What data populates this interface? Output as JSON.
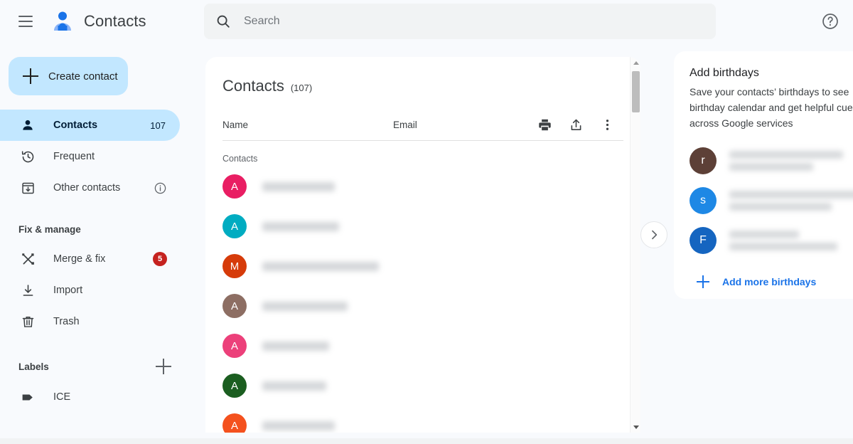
{
  "app": {
    "title": "Contacts",
    "logo_icon": "contacts-person-logo"
  },
  "topbar": {
    "menu_icon": "hamburger-menu-icon",
    "help_icon": "help-circle-icon",
    "search": {
      "icon": "search-icon",
      "placeholder": "Search",
      "value": ""
    }
  },
  "sidebar": {
    "create_button": {
      "label": "Create contact",
      "icon": "plus-icon"
    },
    "nav": [
      {
        "label": "Contacts",
        "icon": "person-icon",
        "count": "107",
        "active": true
      },
      {
        "label": "Frequent",
        "icon": "history-icon",
        "count": "",
        "active": false
      },
      {
        "label": "Other contacts",
        "icon": "archive-down-icon",
        "count": "",
        "active": false,
        "trailing_icon": "info-circle-icon"
      }
    ],
    "fix_section_title": "Fix & manage",
    "fix_items": [
      {
        "label": "Merge & fix",
        "icon": "merge-tools-icon",
        "badge": "5"
      },
      {
        "label": "Import",
        "icon": "download-icon",
        "badge": ""
      },
      {
        "label": "Trash",
        "icon": "trash-icon",
        "badge": ""
      }
    ],
    "labels_section_title": "Labels",
    "add_label_icon": "plus-icon",
    "labels": [
      {
        "label": "ICE",
        "icon": "label-tag-icon"
      }
    ]
  },
  "main": {
    "title": "Contacts",
    "count": "(107)",
    "columns": {
      "name": "Name",
      "email": "Email"
    },
    "actions": [
      {
        "name": "print-button",
        "icon": "print-icon"
      },
      {
        "name": "export-button",
        "icon": "upload-icon"
      },
      {
        "name": "more-options-button",
        "icon": "more-vertical-icon"
      }
    ],
    "group_label": "Contacts",
    "rows": [
      {
        "initial": "A",
        "color": "#e91e63",
        "name_width": 102
      },
      {
        "initial": "A",
        "color": "#00acc1",
        "name_width": 108
      },
      {
        "initial": "M",
        "color": "#d63b0a",
        "name_width": 164
      },
      {
        "initial": "A",
        "color": "#8d6e63",
        "name_width": 120
      },
      {
        "initial": "A",
        "color": "#ec407a",
        "name_width": 94
      },
      {
        "initial": "A",
        "color": "#1b5e20",
        "name_width": 90
      },
      {
        "initial": "A",
        "color": "#f4511e",
        "name_width": 102
      }
    ],
    "scrollbar": {
      "up_icon": "scroll-up-arrow",
      "down_icon": "scroll-down-arrow"
    },
    "panel_toggle_icon": "chevron-right-icon"
  },
  "right_panel": {
    "title": "Add birthdays",
    "description": "Save your contacts’ birthdays to see\nbirthday calendar and get helpful cue\nacross Google services",
    "birthdays": [
      {
        "initial": "r",
        "color": "#5d4037",
        "line1_width": 160,
        "line2_width": 118
      },
      {
        "initial": "s",
        "color": "#1e88e5",
        "line1_width": 184,
        "line2_width": 144
      },
      {
        "initial": "F",
        "color": "#1565c0",
        "line1_width": 98,
        "line2_width": 152
      }
    ],
    "add_more": {
      "label": "Add more birthdays",
      "icon": "plus-icon"
    }
  },
  "colors": {
    "accent_blue": "#1a73e8",
    "selected_pill": "#c2e7ff",
    "badge_red": "#c5221f",
    "page_bg": "#f8fafd",
    "card_bg": "#ffffff"
  }
}
